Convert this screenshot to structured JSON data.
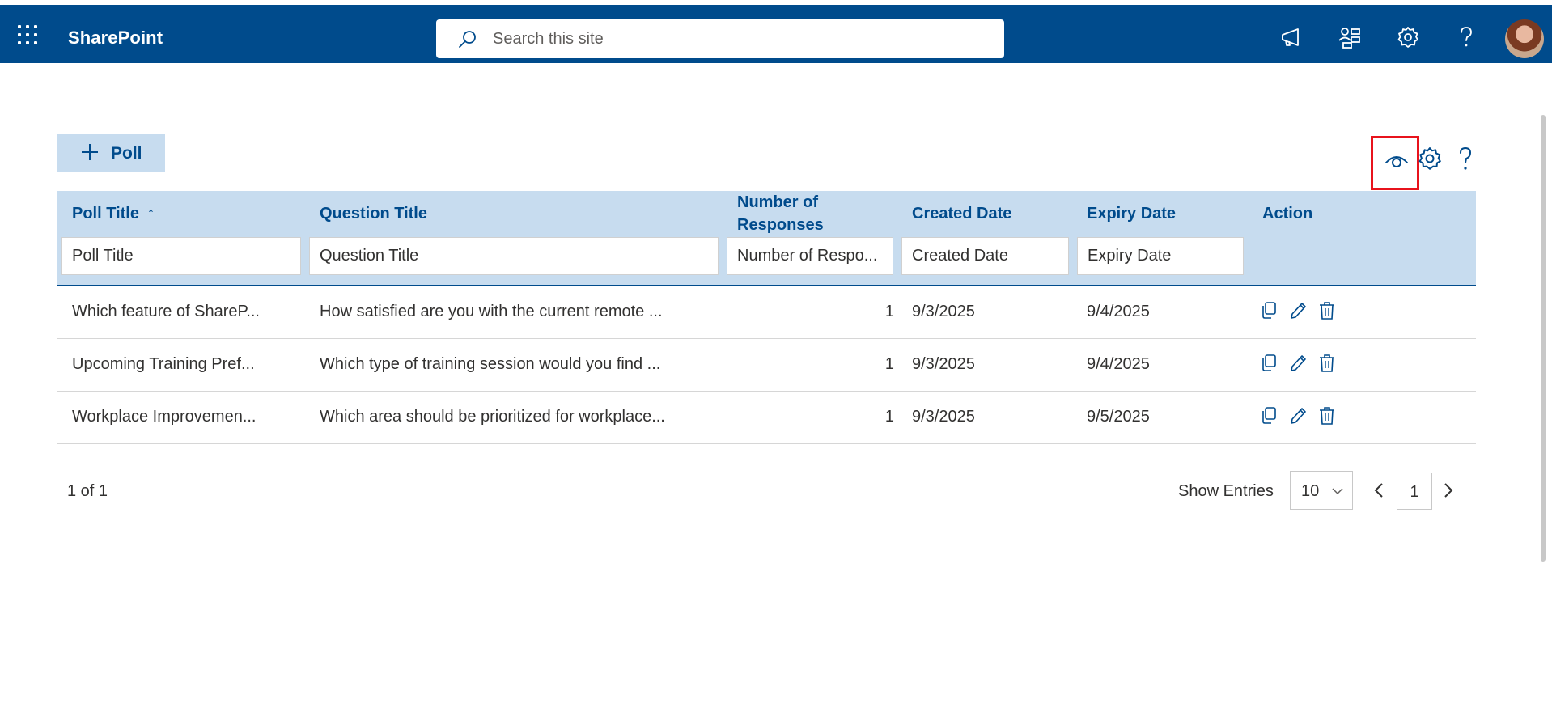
{
  "suite_bar": {
    "brand": "SharePoint",
    "search_placeholder": "Search this site",
    "icons": [
      "app-launcher-icon",
      "megaphone-icon",
      "org-chart-icon",
      "gear-icon",
      "help-icon",
      "avatar"
    ],
    "background_color": "#004b8c"
  },
  "toolbar": {
    "add_button_label": "Poll",
    "right_icons": [
      "eye-icon",
      "gear-icon",
      "help-icon"
    ],
    "highlight_color": "#e8131c"
  },
  "table": {
    "columns": [
      {
        "label": "Poll Title",
        "sort": "ascending",
        "sort_glyph": "↑",
        "filter_placeholder": "Poll Title"
      },
      {
        "label": "Question Title",
        "filter_placeholder": "Question Title"
      },
      {
        "label_line1": "Number of",
        "label_line2": "Responses",
        "filter_placeholder": "Number of Respo..."
      },
      {
        "label": "Created Date",
        "filter_placeholder": "Created Date"
      },
      {
        "label": "Expiry Date",
        "filter_placeholder": "Expiry Date"
      },
      {
        "label": "Action"
      }
    ],
    "rows": [
      {
        "poll_title": "Which feature of ShareP...",
        "question_title": "How satisfied are you with the current remote ...",
        "responses": "1",
        "created": "9/3/2025",
        "expiry": "9/4/2025",
        "actions": [
          "copy-icon",
          "edit-icon",
          "delete-icon"
        ]
      },
      {
        "poll_title": "Upcoming Training Pref...",
        "question_title": "Which type of training session would you find ...",
        "responses": "1",
        "created": "9/3/2025",
        "expiry": "9/4/2025",
        "actions": [
          "copy-icon",
          "edit-icon",
          "delete-icon"
        ]
      },
      {
        "poll_title": "Workplace Improvemen...",
        "question_title": "Which area should be prioritized for workplace...",
        "responses": "1",
        "created": "9/3/2025",
        "expiry": "9/5/2025",
        "actions": [
          "copy-icon",
          "edit-icon",
          "delete-icon"
        ]
      }
    ],
    "header_color": "#c7dcef",
    "accent_color": "#004b8c"
  },
  "footer": {
    "page_info": "1 of 1",
    "show_entries_label": "Show Entries",
    "entries_value": "10",
    "current_page": "1"
  }
}
